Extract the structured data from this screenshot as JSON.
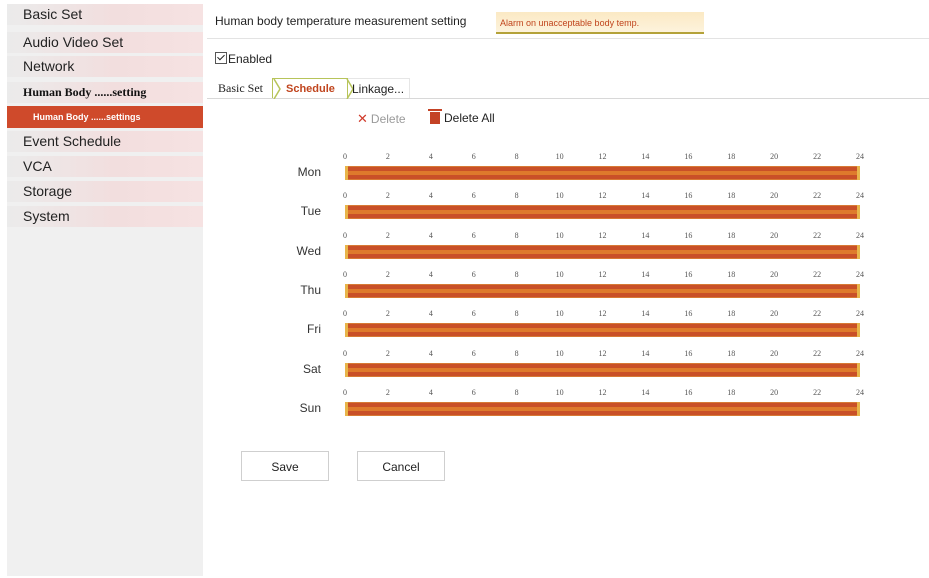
{
  "sidebar": {
    "items": [
      {
        "label": "Basic Set"
      },
      {
        "label": "Audio Video Set"
      },
      {
        "label": "Network"
      },
      {
        "label": "Human Body ......setting"
      },
      {
        "label": "Human Body ......settings"
      },
      {
        "label": "Event Schedule"
      },
      {
        "label": "VCA"
      },
      {
        "label": "Storage"
      },
      {
        "label": "System"
      }
    ]
  },
  "tabs": {
    "measure": "Human body temperature measurement setting",
    "alarm": "Alarm on unacceptable body temp."
  },
  "enabled": {
    "label": "Enabled",
    "checked": true
  },
  "subtabs": {
    "basic": "Basic Set",
    "schedule": "Schedule",
    "linkage": "Linkage..."
  },
  "toolbar": {
    "delete": "Delete",
    "delete_all": "Delete All"
  },
  "schedule": {
    "hour_ticks": [
      "0",
      "2",
      "4",
      "6",
      "8",
      "10",
      "12",
      "14",
      "16",
      "18",
      "20",
      "22",
      "24"
    ],
    "days": [
      {
        "label": "Mon",
        "range": [
          0,
          24
        ]
      },
      {
        "label": "Tue",
        "range": [
          0,
          24
        ]
      },
      {
        "label": "Wed",
        "range": [
          0,
          24
        ]
      },
      {
        "label": "Thu",
        "range": [
          0,
          24
        ]
      },
      {
        "label": "Fri",
        "range": [
          0,
          24
        ]
      },
      {
        "label": "Sat",
        "range": [
          0,
          24
        ]
      },
      {
        "label": "Sun",
        "range": [
          0,
          24
        ]
      }
    ]
  },
  "buttons": {
    "save": "Save",
    "cancel": "Cancel"
  },
  "colors": {
    "accent": "#cf4a2b",
    "bar": "#c95028"
  }
}
